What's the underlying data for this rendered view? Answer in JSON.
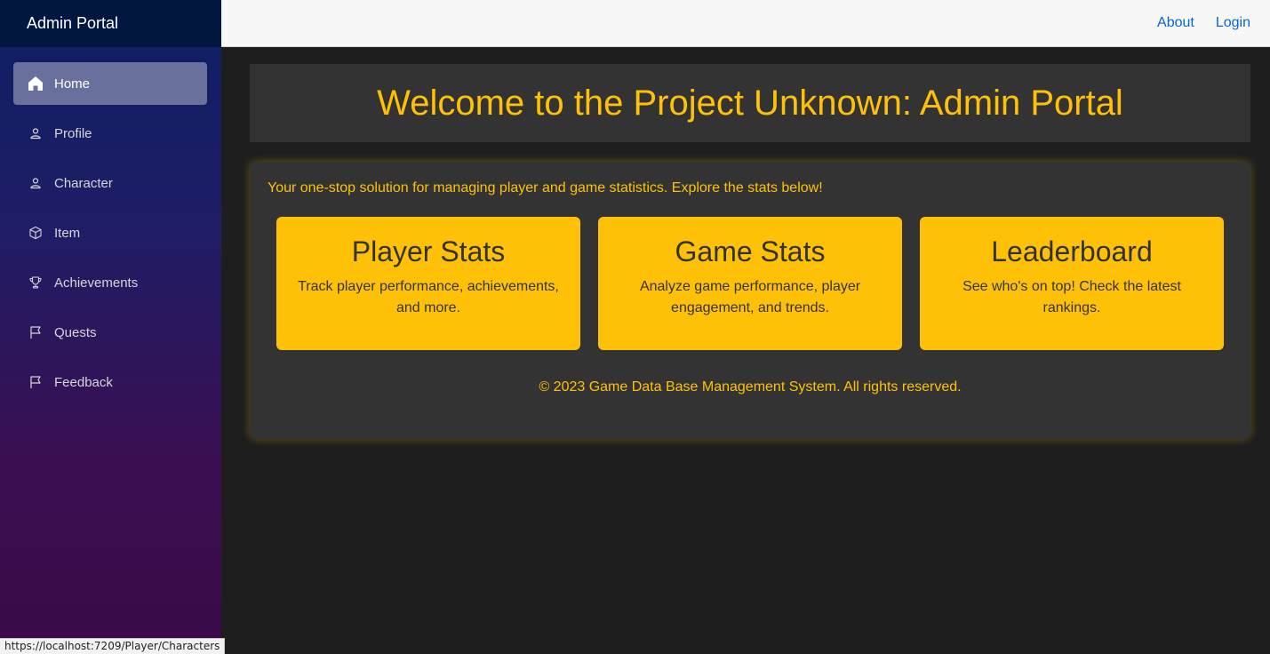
{
  "sidebar": {
    "brand": "Admin Portal",
    "items": [
      {
        "label": "Home",
        "icon": "home-icon"
      },
      {
        "label": "Profile",
        "icon": "person-icon"
      },
      {
        "label": "Character",
        "icon": "person-icon"
      },
      {
        "label": "Item",
        "icon": "box-icon"
      },
      {
        "label": "Achievements",
        "icon": "trophy-icon"
      },
      {
        "label": "Quests",
        "icon": "flag-icon"
      },
      {
        "label": "Feedback",
        "icon": "flag-icon"
      }
    ]
  },
  "topbar": {
    "about": "About",
    "login": "Login"
  },
  "main": {
    "title": "Welcome to the Project Unknown: Admin Portal",
    "tagline": "Your one-stop solution for managing player and game statistics. Explore the stats below!",
    "cards": [
      {
        "title": "Player Stats",
        "text": "Track player performance, achievements, and more."
      },
      {
        "title": "Game Stats",
        "text": "Analyze game performance, player engagement, and trends."
      },
      {
        "title": "Leaderboard",
        "text": "See who's on top! Check the latest rankings."
      }
    ],
    "footer": "© 2023 Game Data Base Management System. All rights reserved."
  },
  "statusbar": {
    "url": "https://localhost:7209/Player/Characters"
  },
  "colors": {
    "accent": "#ffc107",
    "panel": "#333333",
    "link": "#0366d6"
  }
}
